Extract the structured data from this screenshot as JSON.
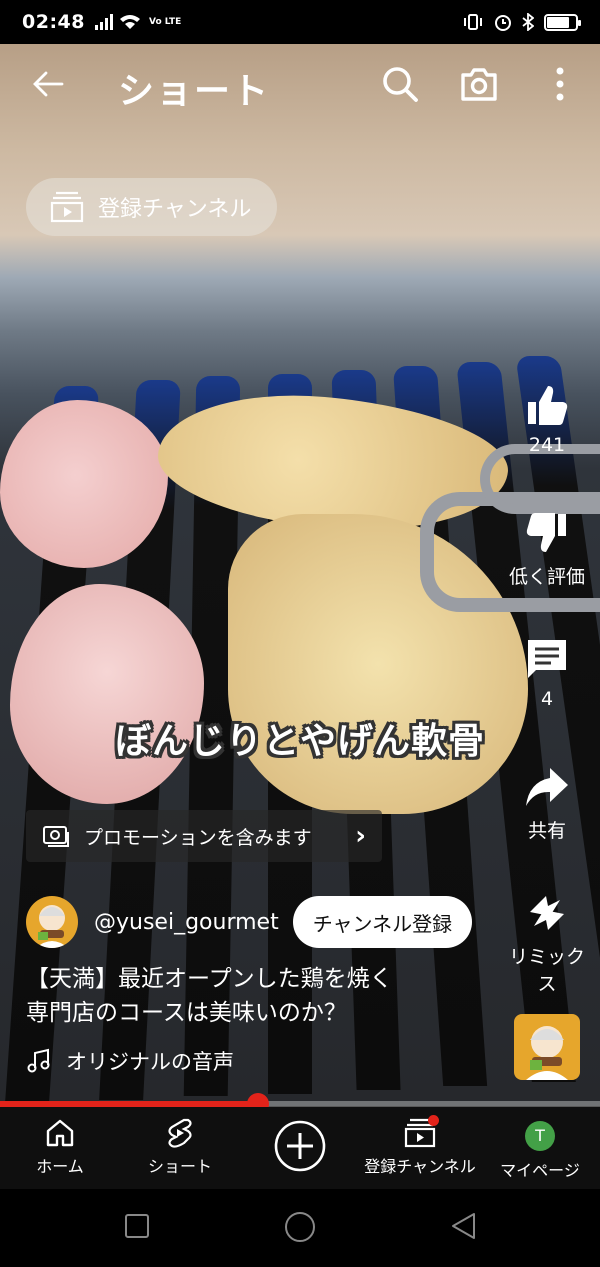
{
  "status_bar": {
    "time": "02:48",
    "volte": "Vo LTE",
    "battery_level": 0.8
  },
  "header": {
    "title": "ショート"
  },
  "subscriptions_chip": {
    "label": "登録チャンネル"
  },
  "video": {
    "overlay_caption": "ぼんじりとやげん軟骨",
    "promotion_label": "プロモーションを含みます",
    "channel_handle": "@yusei_gourmet",
    "subscribe_label": "チャンネル登録",
    "title_lines": [
      "【天満】最近オープンした鶏を焼く",
      "専門店のコースは美味いのか？"
    ],
    "sound_label": "オリジナルの音声",
    "progress": 0.43
  },
  "actions": {
    "like_count": "241",
    "dislike_label": "低く評価",
    "comment_count": "4",
    "share_label": "共有",
    "remix_label": "リミックス"
  },
  "bottom_nav": {
    "items": [
      {
        "label": "ホーム",
        "icon": "home-icon"
      },
      {
        "label": "ショート",
        "icon": "shorts-icon"
      },
      {
        "label": "",
        "icon": "create-plus-icon"
      },
      {
        "label": "登録チャンネル",
        "icon": "subscriptions-icon"
      },
      {
        "label": "マイページ",
        "icon": "avatar-icon",
        "avatar_letter": "T"
      }
    ]
  },
  "colors": {
    "accent_red": "#e2231a",
    "nav_bg": "#0f0f0f",
    "avatar_bg": "#e6a62c",
    "profile_green": "#43a047"
  }
}
